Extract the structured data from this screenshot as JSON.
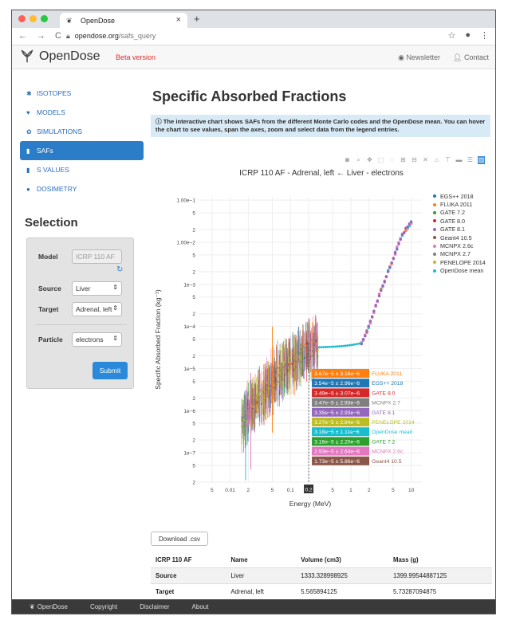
{
  "browser": {
    "tab_title": "OpenDose",
    "new_tab": "+",
    "close_tab": "×",
    "url_host": "opendose.org",
    "url_path": "/safs_query"
  },
  "header": {
    "logo_text": "OpenDose",
    "beta": "Beta version",
    "newsletter": "Newsletter",
    "contact": "Contact"
  },
  "sidebar": {
    "items": [
      {
        "icon": "✱",
        "label": "ISOTOPES"
      },
      {
        "icon": "♥",
        "label": "MODELS"
      },
      {
        "icon": "✿",
        "label": "SIMULATIONS"
      },
      {
        "icon": "▮",
        "label": "SAFs"
      },
      {
        "icon": "▮",
        "label": "S VALUES"
      },
      {
        "icon": "●",
        "label": "DOSIMETRY"
      }
    ]
  },
  "selection": {
    "title": "Selection",
    "model_label": "Model",
    "model_value": "ICRP 110 AF",
    "source_label": "Source",
    "source_value": "Liver",
    "target_label": "Target",
    "target_value": "Adrenal, left",
    "particle_label": "Particle",
    "particle_value": "electrons",
    "submit": "Submit"
  },
  "main": {
    "title": "Specific Absorbed Fractions",
    "info": "The interactive chart shows SAFs from the different Monte Carlo codes and the OpenDose mean. You can hover the chart to see values, span the axes, zoom and select data from the legend entries.",
    "download": "Download .csv"
  },
  "chart_data": {
    "type": "scatter",
    "title": "ICRP 110 AF - Adrenal, left ← Liver - electrons",
    "xlabel": "Energy (MeV)",
    "ylabel": "Specific Absorbed Fraction (kg⁻¹)",
    "x_scale": "log",
    "y_scale": "log",
    "x_ticks": [
      "5",
      "0.01",
      "2",
      "5",
      "0.1",
      "2",
      "5",
      "1",
      "2",
      "5",
      "10"
    ],
    "x_highlight_tick": "0.2",
    "y_ticks": [
      "1.00e−1",
      "5",
      "2",
      "1.00e−2",
      "5",
      "2",
      "1e−3",
      "5",
      "2",
      "1e−4",
      "5",
      "2",
      "1e−5",
      "5",
      "2",
      "1e−6",
      "5",
      "2",
      "1e−7",
      "5",
      "2"
    ],
    "legend_position": "right",
    "series": [
      {
        "name": "EGS++ 2018",
        "color": "#1f77b4"
      },
      {
        "name": "FLUKA 2011",
        "color": "#ff7f0e"
      },
      {
        "name": "GATE 7.2",
        "color": "#2ca02c"
      },
      {
        "name": "GATE 8.0",
        "color": "#d62728"
      },
      {
        "name": "GATE 8.1",
        "color": "#9467bd"
      },
      {
        "name": "Geant4 10.5",
        "color": "#8c564b"
      },
      {
        "name": "MCNPX 2.6c",
        "color": "#e377c2"
      },
      {
        "name": "MCNPX 2.7",
        "color": "#7f7f7f"
      },
      {
        "name": "PENELOPE 2014",
        "color": "#bcbd22"
      },
      {
        "name": "OpenDose mean",
        "color": "#17becf"
      }
    ],
    "hover_x": 0.2,
    "hover_labels": [
      {
        "value": "3.67e−5 ± 3.16e−6",
        "name": "FLUKA 2011",
        "color": "#ff7f0e"
      },
      {
        "value": "3.54e−5 ± 2.96e−6",
        "name": "EGS++ 2018",
        "color": "#1f77b4"
      },
      {
        "value": "3.49e−5 ± 3.07e−6",
        "name": "GATE 8.0",
        "color": "#d62728"
      },
      {
        "value": "3.47e−5 ± 2.93e−6",
        "name": "MCNPX 2.7",
        "color": "#7f7f7f"
      },
      {
        "value": "3.35e−5 ± 2.93e−6",
        "name": "GATE 8.1",
        "color": "#9467bd"
      },
      {
        "value": "3.27e−5 ± 2.84e−6",
        "name": "PENELOPE 2014",
        "color": "#bcbd22"
      },
      {
        "value": "3.18e−5 ± 1.11e−6",
        "name": "OpenDose mean",
        "color": "#17becf"
      },
      {
        "value": "3.16e−5 ± 2.20e−6",
        "name": "GATE 7.2",
        "color": "#2ca02c"
      },
      {
        "value": "2.93e−5 ± 2.64e−6",
        "name": "MCNPX 2.6c",
        "color": "#e377c2"
      },
      {
        "value": "1.73e−5 ± 5.86e−6",
        "name": "Geant4 10.5",
        "color": "#8c564b"
      }
    ],
    "mean_curve": {
      "x": [
        0.015,
        0.02,
        0.03,
        0.04,
        0.05,
        0.07,
        0.1,
        0.15,
        0.2,
        0.3,
        0.5,
        0.7,
        1,
        1.5,
        2,
        3,
        5,
        7,
        10
      ],
      "y": [
        5e-07,
        1e-06,
        2e-06,
        3e-06,
        5e-06,
        8e-06,
        1.2e-05,
        2e-05,
        3.2e-05,
        3.2e-05,
        3.3e-05,
        3.4e-05,
        3.6e-05,
        4e-05,
        0.0001,
        0.0006,
        0.004,
        0.015,
        0.03
      ]
    }
  },
  "table": {
    "headers": [
      "ICRP 110 AF",
      "Name",
      "Volume (cm3)",
      "Mass (g)"
    ],
    "rows": [
      {
        "label": "Source",
        "name": "Liver",
        "volume": "1333.328998925",
        "mass": "1399.99544887125"
      },
      {
        "label": "Target",
        "name": "Adrenal, left",
        "volume": "5.565894125",
        "mass": "5.73287094875"
      }
    ]
  },
  "footer": {
    "brand": "OpenDose",
    "links": [
      "Copyright",
      "Disclaimer",
      "About"
    ]
  }
}
